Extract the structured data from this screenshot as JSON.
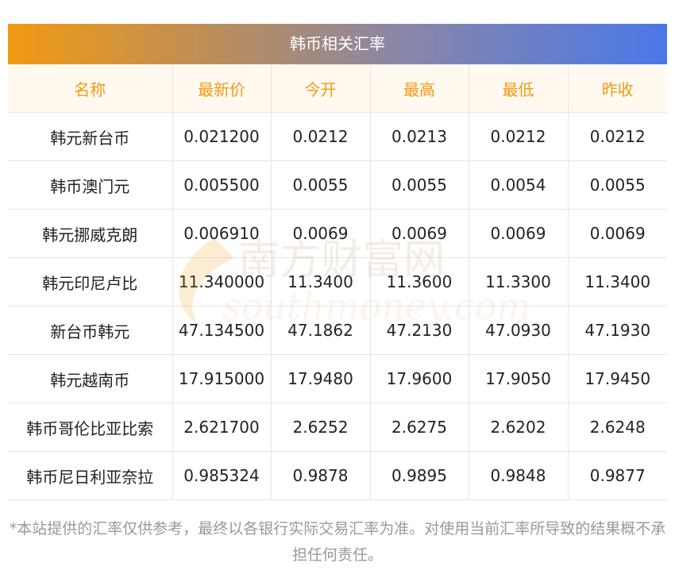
{
  "title": "韩币相关汇率",
  "columns": [
    "名称",
    "最新价",
    "今开",
    "最高",
    "最低",
    "昨收"
  ],
  "rows": [
    [
      "韩元新台币",
      "0.021200",
      "0.0212",
      "0.0213",
      "0.0212",
      "0.0212"
    ],
    [
      "韩币澳门元",
      "0.005500",
      "0.0055",
      "0.0055",
      "0.0054",
      "0.0055"
    ],
    [
      "韩元挪威克朗",
      "0.006910",
      "0.0069",
      "0.0069",
      "0.0069",
      "0.0069"
    ],
    [
      "韩元印尼卢比",
      "11.340000",
      "11.3400",
      "11.3600",
      "11.3300",
      "11.3400"
    ],
    [
      "新台币韩元",
      "47.134500",
      "47.1862",
      "47.2130",
      "47.0930",
      "47.1930"
    ],
    [
      "韩元越南币",
      "17.915000",
      "17.9480",
      "17.9600",
      "17.9050",
      "17.9450"
    ],
    [
      "韩币哥伦比亚比索",
      "2.621700",
      "2.6252",
      "2.6275",
      "2.6202",
      "2.6248"
    ],
    [
      "韩币尼日利亚奈拉",
      "0.985324",
      "0.9878",
      "0.9895",
      "0.9848",
      "0.9877"
    ]
  ],
  "watermark": {
    "cn": "南方财富网",
    "en": "southmoney.com"
  },
  "note": "*本站提供的汇率仅供参考，最终以各银行实际交易汇率为准。对使用当前汇率所导致的结果概不承担任何责任。",
  "colors": {
    "header_text": "#f29a12",
    "gradient_start": "#f29a12",
    "gradient_end": "#4a78e8"
  }
}
